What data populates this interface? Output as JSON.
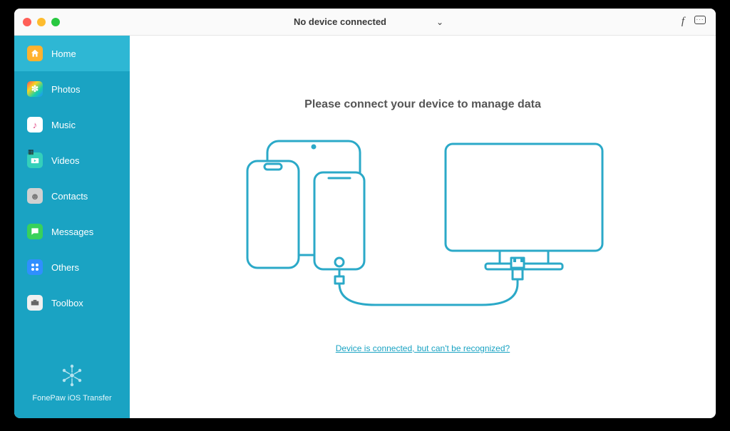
{
  "header": {
    "device_status_label": "No device connected"
  },
  "sidebar": {
    "items": [
      {
        "label": "Home"
      },
      {
        "label": "Photos"
      },
      {
        "label": "Music"
      },
      {
        "label": "Videos"
      },
      {
        "label": "Contacts"
      },
      {
        "label": "Messages"
      },
      {
        "label": "Others"
      },
      {
        "label": "Toolbox"
      }
    ],
    "brand": "FonePaw iOS Transfer"
  },
  "main": {
    "title": "Please connect your device to manage data",
    "help_link": "Device is connected, but can't be recognized?"
  },
  "colors": {
    "accent": "#1aa3c3"
  }
}
